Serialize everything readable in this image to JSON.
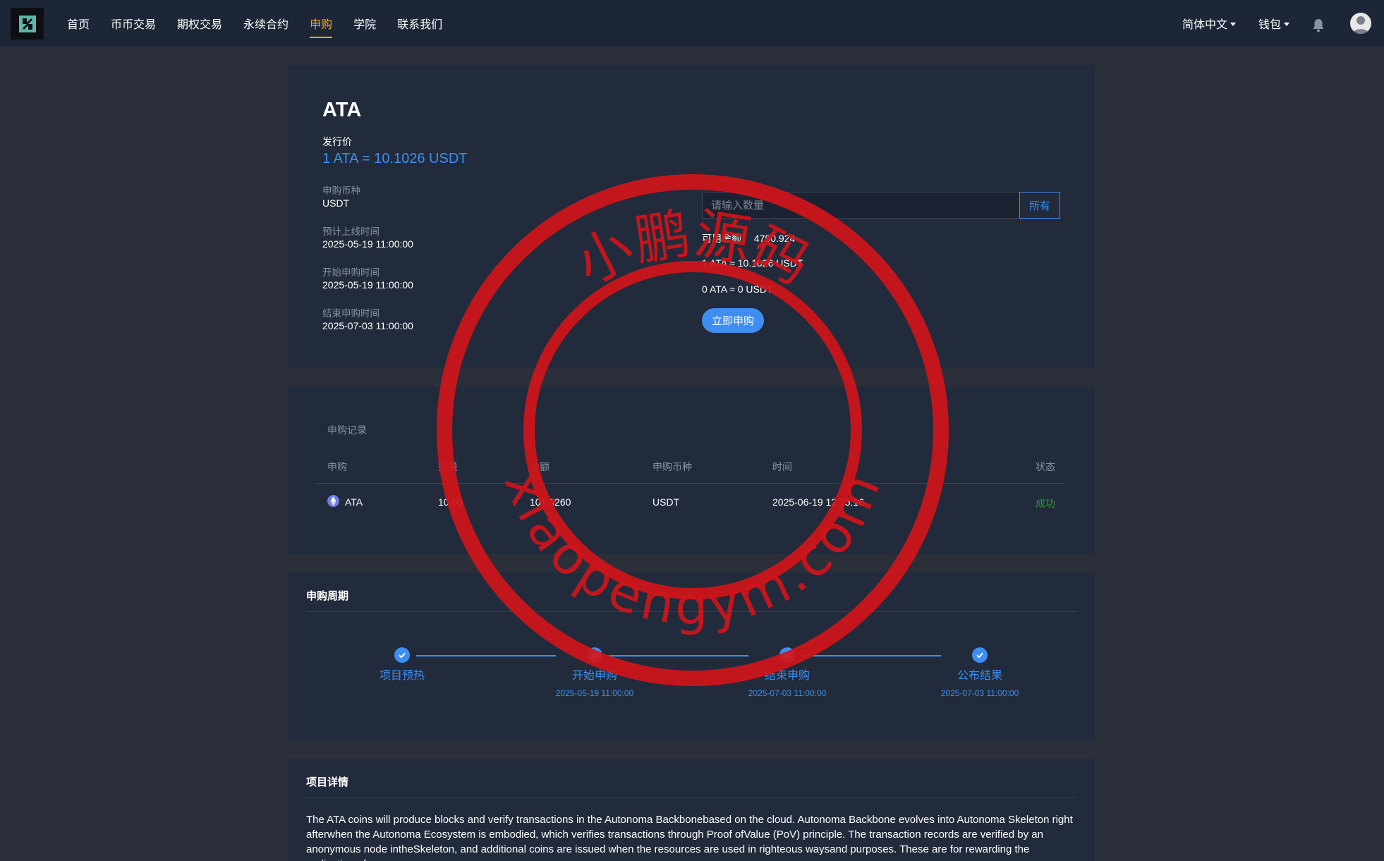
{
  "nav": {
    "items": [
      {
        "label": "首页"
      },
      {
        "label": "币币交易"
      },
      {
        "label": "期权交易"
      },
      {
        "label": "永续合约"
      },
      {
        "label": "申购",
        "active": true
      },
      {
        "label": "学院"
      },
      {
        "label": "联系我们"
      }
    ],
    "language": "简体中文",
    "wallet": "钱包",
    "active_color": "#f5a623"
  },
  "project": {
    "coin": "ATA",
    "issue_price_label": "发行价",
    "issue_price": "1 ATA = 10.1026 USDT",
    "fields": [
      {
        "label": "申购币种",
        "value": "USDT"
      },
      {
        "label": "预计上线时间",
        "value": "2025-05-19 11:00:00"
      },
      {
        "label": "开始申购时间",
        "value": "2025-05-19 11:00:00"
      },
      {
        "label": "结束申购时间",
        "value": "2025-07-03 11:00:00"
      }
    ]
  },
  "subscribe": {
    "placeholder": "请输入数量",
    "all_label": "所有",
    "available": "可用余额： 4790.924",
    "rate": "1 ATA ≈ 10.1026 USDT",
    "estimate": "0 ATA ≈ 0 USDT",
    "buy_label": "立即申购"
  },
  "records": {
    "title": "申购记录",
    "headers": [
      "申购",
      "数量",
      "金额",
      "申购币种",
      "时间",
      "状态"
    ],
    "rows": [
      {
        "coin": "ATA",
        "qty": "10.00",
        "amount": "101.0260",
        "currency": "USDT",
        "time": "2025-06-19 12:15:16",
        "status": "成功"
      }
    ],
    "status_color": "#1fa12e"
  },
  "cycle": {
    "title": "申购周期",
    "steps": [
      {
        "name": "项目预热",
        "date": ""
      },
      {
        "name": "开始申购",
        "date": "2025-05-19 11:00:00"
      },
      {
        "name": "结束申购",
        "date": "2025-07-03 11:00:00"
      },
      {
        "name": "公布结果",
        "date": "2025-07-03 11:00:00"
      }
    ],
    "accent": "#3d8ef0"
  },
  "details": {
    "title": "项目详情",
    "text": "The ATA coins will produce blocks and verify transactions in the Autonoma Backbonebased on the cloud. Autonoma Backbone evolves into Autonoma Skeleton right afterwhen the Autonoma Ecosystem is embodied, which verifies transactions through Proof ofValue (PoV) principle. The transaction records are verified by an anonymous node intheSkeleton, and additional coins are issued when the resources are used in righteous waysand purposes. These are for rewarding the realization of"
  },
  "watermark": {
    "cn": "小鹏源码",
    "en": "xiaopengym.com",
    "color": "#d0141a"
  }
}
